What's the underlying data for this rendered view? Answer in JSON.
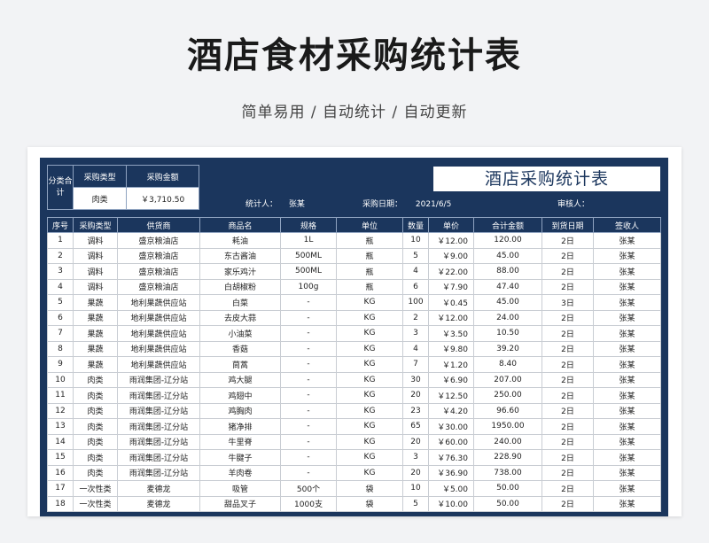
{
  "header": {
    "title": "酒店食材采购统计表",
    "subtitle": "简单易用 / 自动统计 / 自动更新"
  },
  "sheet": {
    "title": "酒店采购统计表",
    "summary": {
      "category_label": "分类合计",
      "col_type": "采购类型",
      "col_amount": "采购金额",
      "type_value": "肉类",
      "amount_value": "￥3,710.50"
    },
    "meta": {
      "stat_label": "统计人：",
      "stat_value": "张某",
      "date_label": "采购日期：",
      "date_value": "2021/6/5",
      "reviewer_label": "审核人："
    },
    "columns": [
      "序号",
      "采购类型",
      "供货商",
      "商品名",
      "规格",
      "单位",
      "数量",
      "单价",
      "合计金额",
      "到货日期",
      "签收人"
    ],
    "rows": [
      [
        "1",
        "调料",
        "盛京粮油店",
        "耗油",
        "1L",
        "瓶",
        "10",
        "￥12.00",
        "120.00",
        "2日",
        "张某"
      ],
      [
        "2",
        "调料",
        "盛京粮油店",
        "东古酱油",
        "500ML",
        "瓶",
        "5",
        "￥9.00",
        "45.00",
        "2日",
        "张某"
      ],
      [
        "3",
        "调料",
        "盛京粮油店",
        "家乐鸡汁",
        "500ML",
        "瓶",
        "4",
        "￥22.00",
        "88.00",
        "2日",
        "张某"
      ],
      [
        "4",
        "调料",
        "盛京粮油店",
        "白胡椒粉",
        "100g",
        "瓶",
        "6",
        "￥7.90",
        "47.40",
        "2日",
        "张某"
      ],
      [
        "5",
        "果蔬",
        "地利果蔬供应站",
        "白菜",
        "-",
        "KG",
        "100",
        "￥0.45",
        "45.00",
        "3日",
        "张某"
      ],
      [
        "6",
        "果蔬",
        "地利果蔬供应站",
        "去皮大蒜",
        "-",
        "KG",
        "2",
        "￥12.00",
        "24.00",
        "2日",
        "张某"
      ],
      [
        "7",
        "果蔬",
        "地利果蔬供应站",
        "小油菜",
        "-",
        "KG",
        "3",
        "￥3.50",
        "10.50",
        "2日",
        "张某"
      ],
      [
        "8",
        "果蔬",
        "地利果蔬供应站",
        "香菇",
        "-",
        "KG",
        "4",
        "￥9.80",
        "39.20",
        "2日",
        "张某"
      ],
      [
        "9",
        "果蔬",
        "地利果蔬供应站",
        "茼蒿",
        "-",
        "KG",
        "7",
        "￥1.20",
        "8.40",
        "2日",
        "张某"
      ],
      [
        "10",
        "肉类",
        "雨润集团-辽分站",
        "鸡大腿",
        "-",
        "KG",
        "30",
        "￥6.90",
        "207.00",
        "2日",
        "张某"
      ],
      [
        "11",
        "肉类",
        "雨润集团-辽分站",
        "鸡翅中",
        "-",
        "KG",
        "20",
        "￥12.50",
        "250.00",
        "2日",
        "张某"
      ],
      [
        "12",
        "肉类",
        "雨润集团-辽分站",
        "鸡胸肉",
        "-",
        "KG",
        "23",
        "￥4.20",
        "96.60",
        "2日",
        "张某"
      ],
      [
        "13",
        "肉类",
        "雨润集团-辽分站",
        "猪净排",
        "-",
        "KG",
        "65",
        "￥30.00",
        "1950.00",
        "2日",
        "张某"
      ],
      [
        "14",
        "肉类",
        "雨润集团-辽分站",
        "牛里脊",
        "-",
        "KG",
        "20",
        "￥60.00",
        "240.00",
        "2日",
        "张某"
      ],
      [
        "15",
        "肉类",
        "雨润集团-辽分站",
        "牛腱子",
        "-",
        "KG",
        "3",
        "￥76.30",
        "228.90",
        "2日",
        "张某"
      ],
      [
        "16",
        "肉类",
        "雨润集团-辽分站",
        "羊肉卷",
        "-",
        "KG",
        "20",
        "￥36.90",
        "738.00",
        "2日",
        "张某"
      ],
      [
        "17",
        "一次性类",
        "麦德龙",
        "吸管",
        "500个",
        "袋",
        "10",
        "￥5.00",
        "50.00",
        "2日",
        "张某"
      ],
      [
        "18",
        "一次性类",
        "麦德龙",
        "甜品叉子",
        "1000支",
        "袋",
        "5",
        "￥10.00",
        "50.00",
        "2日",
        "张某"
      ]
    ]
  }
}
